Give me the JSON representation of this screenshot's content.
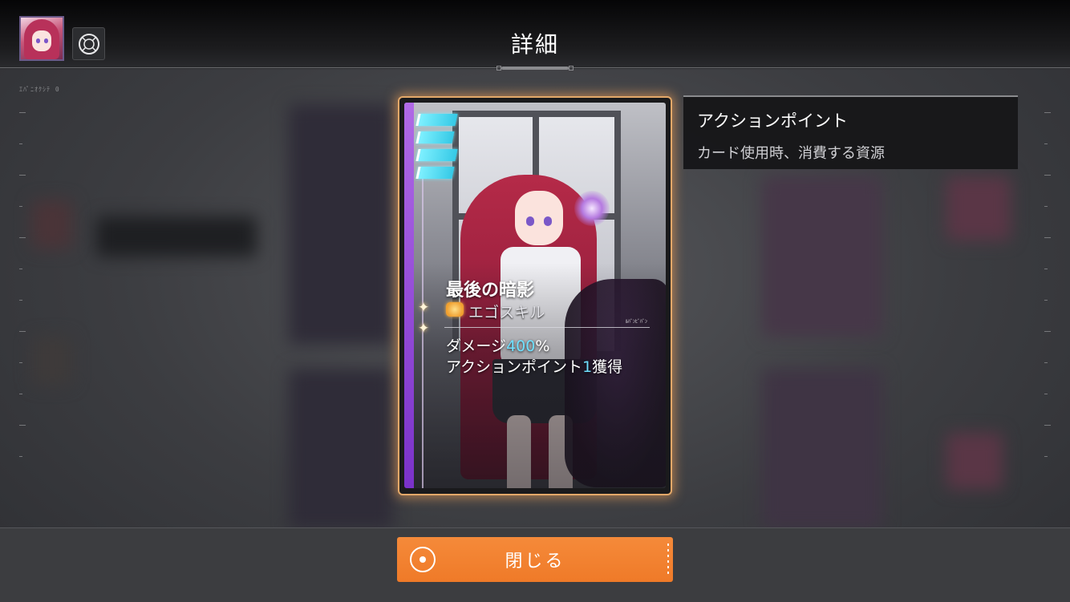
{
  "header": {
    "title": "詳細",
    "avatar_icon": "character-avatar-icon",
    "menu_icon": "target-circle-icon"
  },
  "hud": {
    "label": "ｴﾊﾟﾆｵｸｼﾃ  0"
  },
  "card": {
    "name": "最後の暗影",
    "skill_icon": "ego-burst-icon",
    "skill_type": "エゴスキル",
    "tag": "ﾙﾊﾞﾝﾋﾞﾊﾞﾝ",
    "ap_cost_bars": 4,
    "desc_line1_prefix": "ダメージ",
    "desc_line1_value": "400",
    "desc_line1_suffix": "%",
    "desc_line2_prefix": "アクションポイント",
    "desc_line2_value": "1",
    "desc_line2_suffix": "獲得",
    "colors": {
      "frame": "#e3a869",
      "rail": "#9b4fdc",
      "highlight": "#6fe0ff"
    }
  },
  "tooltip": {
    "title": "アクションポイント",
    "description": "カード使用時、消費する資源"
  },
  "footer": {
    "close_label": "閉じる",
    "close_icon": "circle-dot-icon",
    "button_color": "#f2802e"
  }
}
